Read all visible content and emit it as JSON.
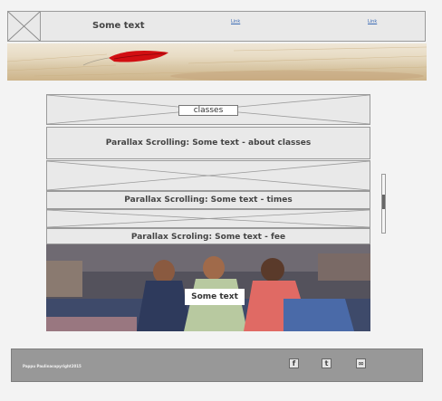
{
  "header": {
    "title": "Some text",
    "links": [
      "Link",
      "Link"
    ]
  },
  "sections": {
    "classes_label": "classes",
    "about_title": "Parallax Scrolling:  Some text - about classes",
    "times_title": "Parallax Scrolling:  Some text - times",
    "fee_title": "Parallax Scroling:  Some text - fee",
    "photo_label": "Some text"
  },
  "footer": {
    "copyright": "Pappu Paulinacopyright2015",
    "social_icons": [
      "facebook-icon",
      "twitter-icon",
      "link-icon"
    ]
  },
  "colors": {
    "wireframe_fill": "#e9e9e9",
    "wireframe_border": "#9a9a9a",
    "footer_fill": "#989898",
    "link": "#3a6bb5"
  }
}
